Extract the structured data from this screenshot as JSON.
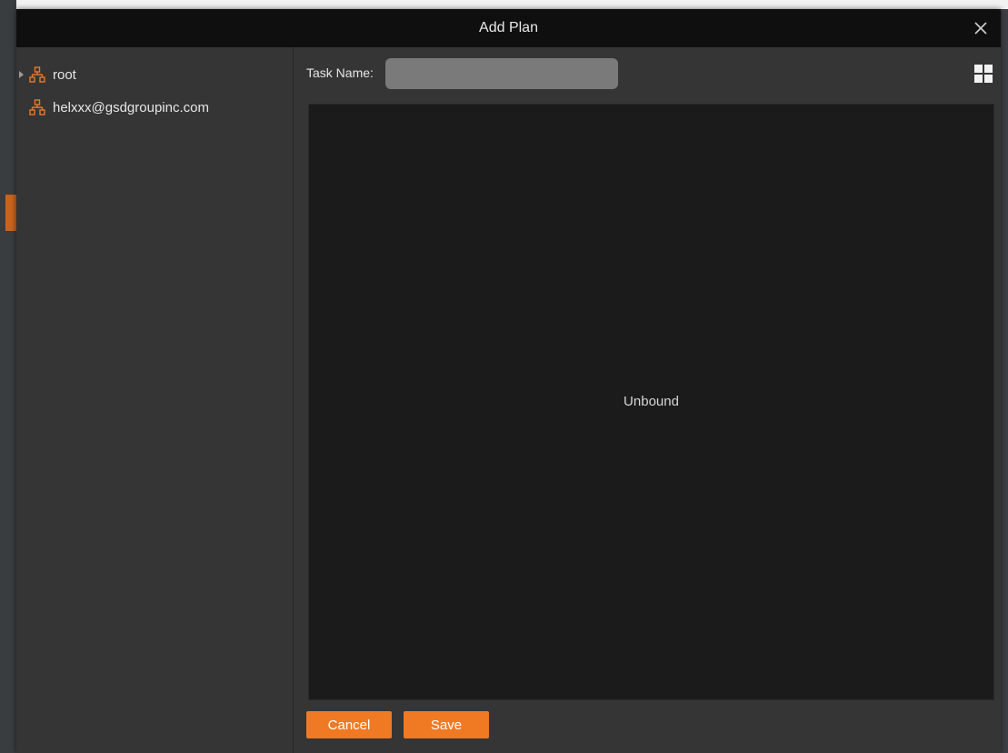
{
  "dialog": {
    "title": "Add Plan"
  },
  "tree": {
    "items": [
      {
        "label": "root",
        "expandable": true
      },
      {
        "label": "helxxx@gsdgroupinc.com",
        "expandable": false
      }
    ]
  },
  "form": {
    "task_name_label": "Task Name:",
    "task_name_value": ""
  },
  "canvas": {
    "status_text": "Unbound"
  },
  "buttons": {
    "cancel_label": "Cancel",
    "save_label": "Save"
  },
  "colors": {
    "accent": "#f07a23",
    "icon_orange": "#e8782a",
    "dialog_bg": "#353535",
    "canvas_bg": "#1b1b1b",
    "titlebar_bg": "#0f0f0f"
  },
  "icons": {
    "close": "close-icon",
    "tree_node": "org-chart-icon",
    "expand": "caret-right-icon",
    "layout": "grid-layout-icon"
  }
}
